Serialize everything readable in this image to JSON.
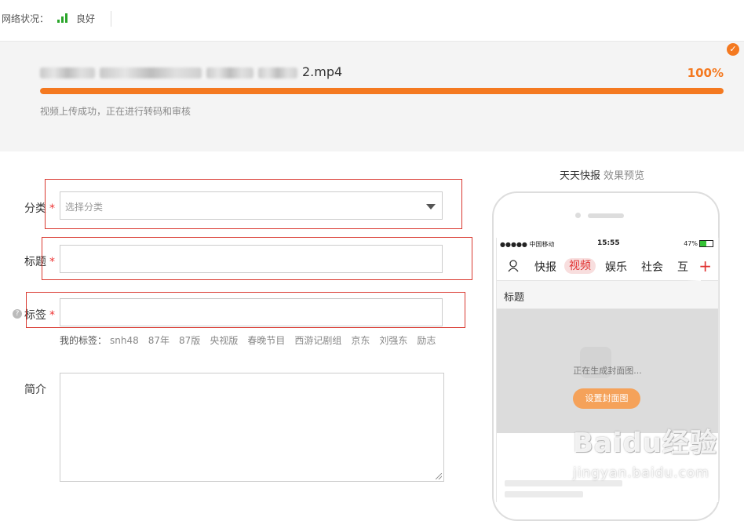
{
  "topbar": {
    "network_label": "网络状况：",
    "network_status": "良好",
    "signal_color": "#2aa52a"
  },
  "upload": {
    "filename_suffix": "2.mp4",
    "percent_text": "100%",
    "progress": 1.0,
    "message": "视频上传成功，正在进行转码和审核",
    "accent_color": "#f47920"
  },
  "form": {
    "category": {
      "label": "分类",
      "required": "*",
      "placeholder": "选择分类"
    },
    "title": {
      "label": "标题",
      "required": "*"
    },
    "tags": {
      "label": "标签",
      "required": "*",
      "my_tags_label": "我的标签：",
      "items": [
        "snh48",
        "87年",
        "87版",
        "央视版",
        "春晚节目",
        "西游记剧组",
        "京东",
        "刘强东",
        "励志"
      ]
    },
    "intro": {
      "label": "简介"
    }
  },
  "preview": {
    "title": "天天快报",
    "subtitle": "效果预览",
    "status_bar": {
      "carrier": "●●●●● 中国移动",
      "time": "15:55",
      "battery": "47%"
    },
    "nav": [
      "快报",
      "视频",
      "娱乐",
      "社会",
      "互"
    ],
    "nav_active_index": 1,
    "headline": "标题",
    "cover_message": "正在生成封面图...",
    "cover_button": "设置封面图"
  },
  "watermark": {
    "brand": "Baidu经验",
    "url": "jingyan.baidu.com"
  },
  "icons": {
    "signal": "signal-bars-icon",
    "check": "check-circle-icon",
    "caret": "chevron-down-icon",
    "help": "question-icon",
    "user": "user-icon",
    "plus": "plus-icon"
  }
}
